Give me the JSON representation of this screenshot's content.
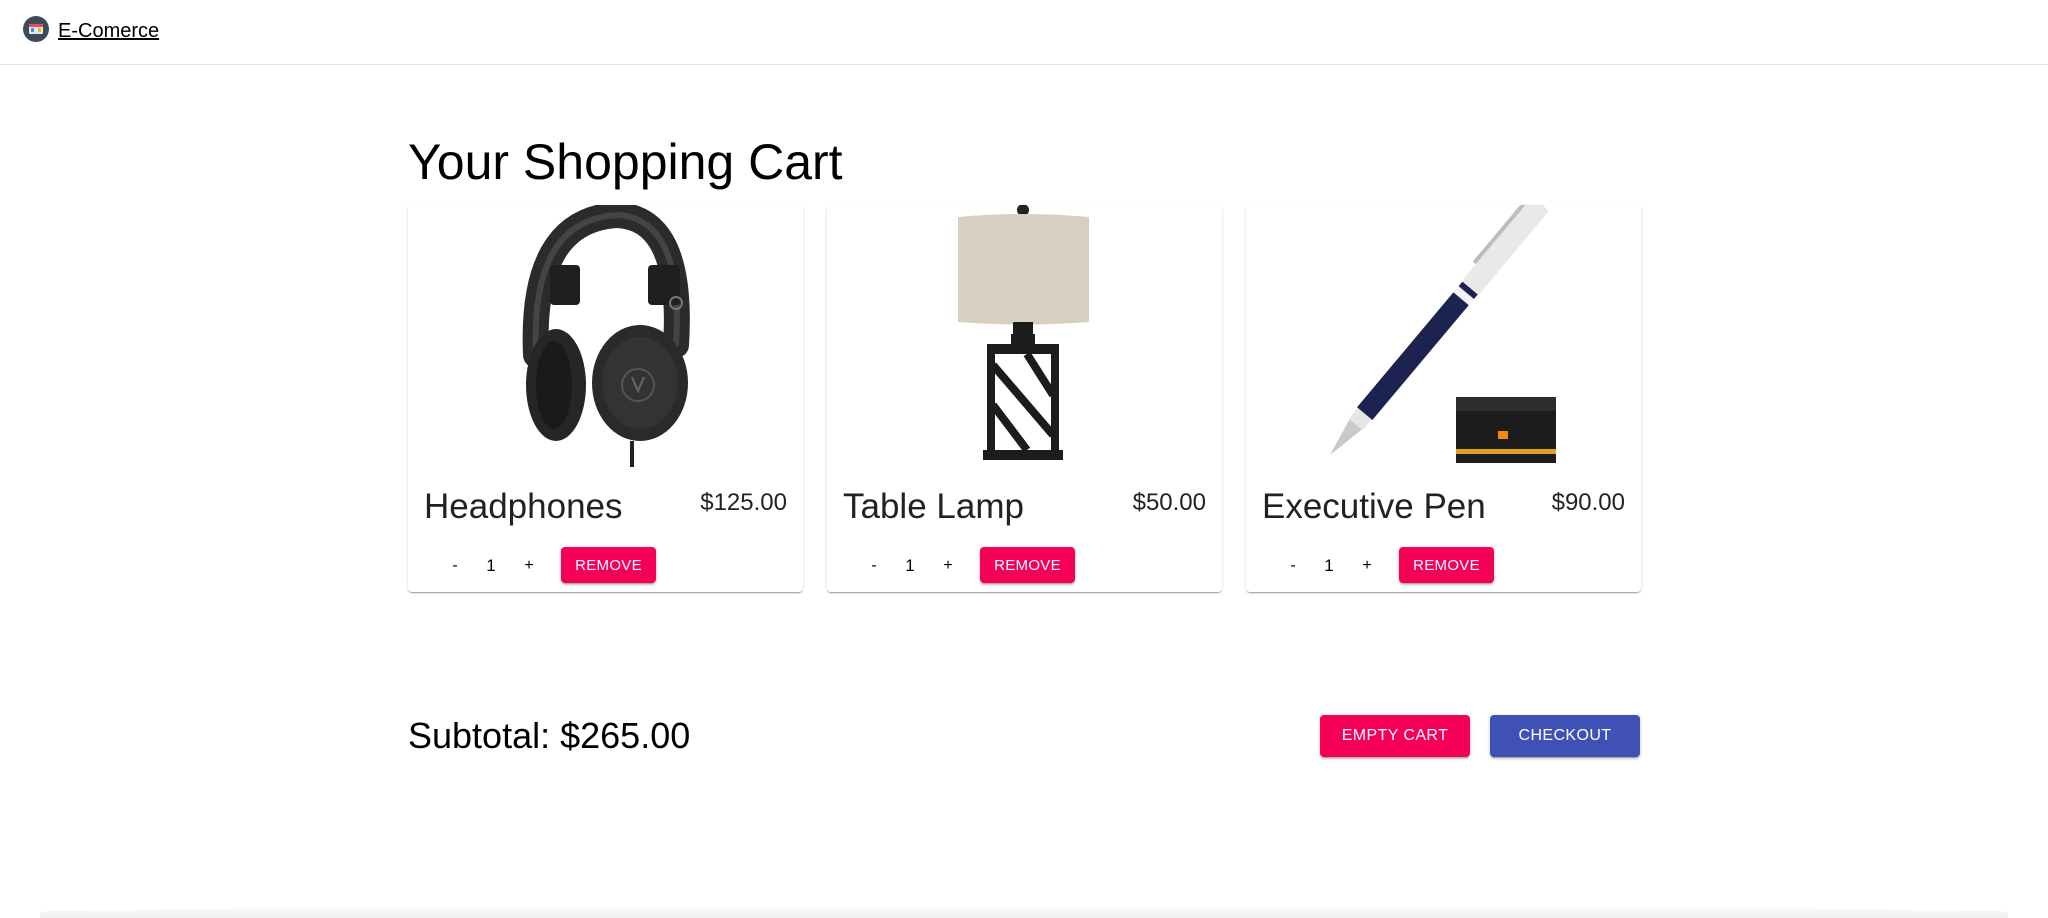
{
  "appbar": {
    "brand_label": "E-Comerce"
  },
  "cart": {
    "title": "Your Shopping Cart",
    "items": [
      {
        "name": "Headphones",
        "price": "$125.00",
        "quantity": "1",
        "minus_label": "-",
        "plus_label": "+",
        "remove_label": "Remove",
        "image_icon": "headphones-image"
      },
      {
        "name": "Table Lamp",
        "price": "$50.00",
        "quantity": "1",
        "minus_label": "-",
        "plus_label": "+",
        "remove_label": "Remove",
        "image_icon": "table-lamp-image"
      },
      {
        "name": "Executive Pen",
        "price": "$90.00",
        "quantity": "1",
        "minus_label": "-",
        "plus_label": "+",
        "remove_label": "Remove",
        "image_icon": "executive-pen-image"
      }
    ],
    "subtotal": "Subtotal: $265.00",
    "empty_label": "Empty Cart",
    "checkout_label": "Checkout"
  },
  "colors": {
    "secondary": "#f50057",
    "primary": "#3f51b5"
  }
}
